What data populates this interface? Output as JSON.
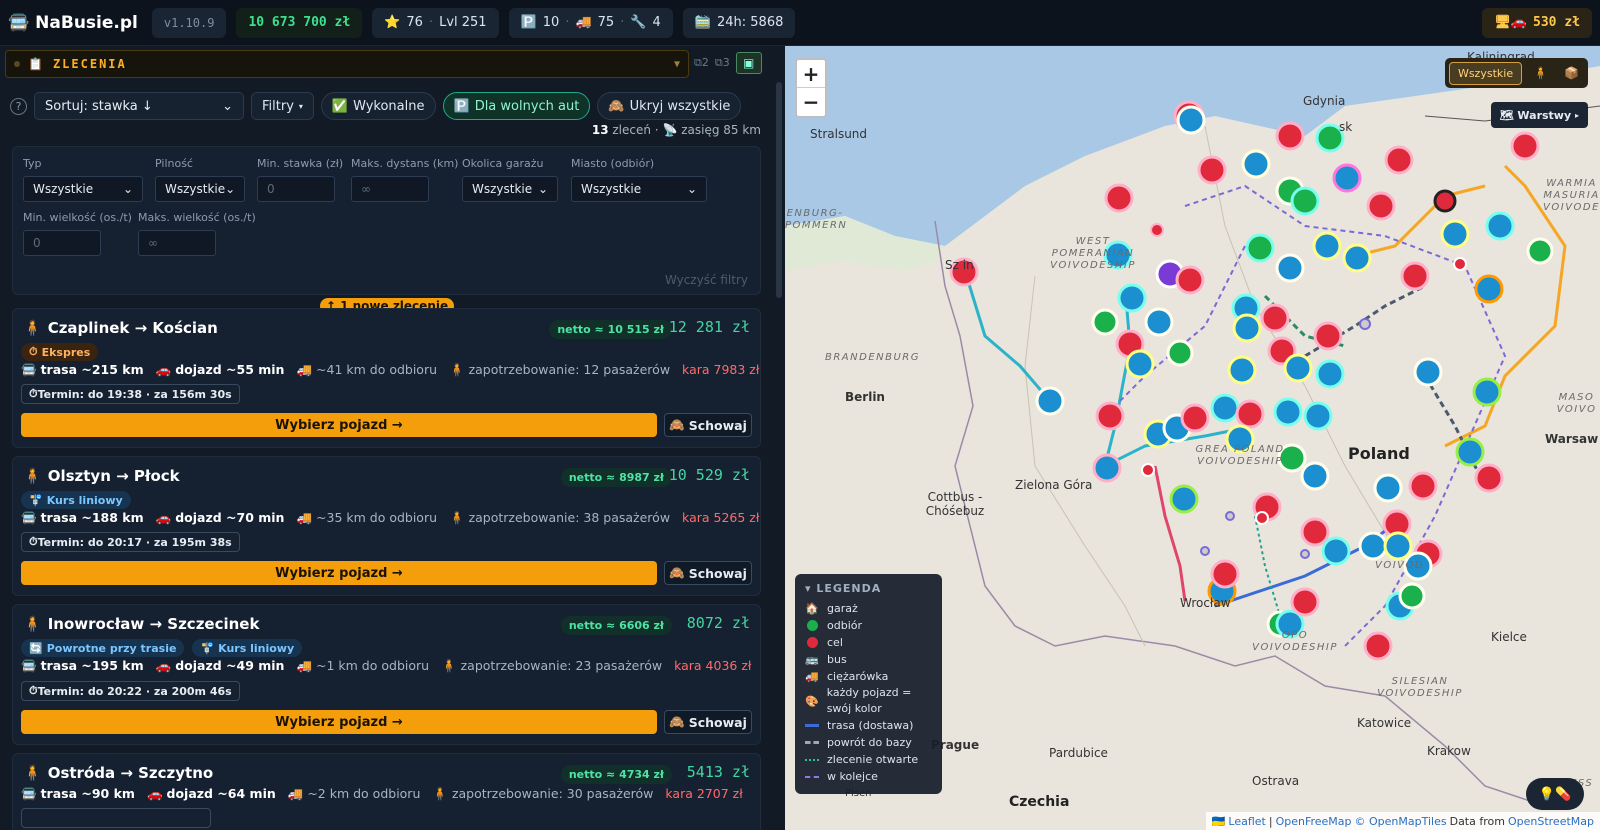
{
  "topbar": {
    "brand": "NaBusie.pl",
    "version": "v1.10.9",
    "money": "10 673 700 zł",
    "stars": "76",
    "level": "Lvl 251",
    "parking": "10",
    "trucks": "75",
    "tools": "4",
    "day24": "24h: 5868",
    "right_money": "530 zł"
  },
  "orders_header": {
    "title": "ZLECENIA",
    "tab2": "2",
    "tab3": "3"
  },
  "controls": {
    "sort": "Sortuj: stawka ↓",
    "filters": "Filtry",
    "done": "Wykonalne",
    "free": "Dla wolnych aut",
    "hide_all": "Ukryj wszystkie",
    "count": "13",
    "count_suffix": "zleceń ·",
    "range": "zasięg 85 km"
  },
  "filters": {
    "type_label": "Typ",
    "type_value": "Wszystkie",
    "urgency_label": "Pilność",
    "urgency_value": "Wszystkie",
    "min_rate_label": "Min. stawka (zł)",
    "min_rate_value": "0",
    "max_dist_label": "Maks. dystans (km)",
    "max_dist_value": "∞",
    "garage_label": "Okolica garażu",
    "garage_value": "Wszystkie",
    "city_label": "Miasto (odbiór)",
    "city_value": "Wszystkie",
    "min_size_label": "Min. wielkość (os./t)",
    "min_size_value": "0",
    "max_size_label": "Maks. wielkość (os./t)",
    "max_size_value": "∞",
    "clear": "Wyczyść filtry"
  },
  "new_badge": "↑ 1 nowe zlecenie",
  "orders": [
    {
      "title": "Czaplinek → Kościan",
      "net": "netto ≈ 10 515 zł",
      "price": "12 281 zł",
      "tags": [
        "Ekspres"
      ],
      "route": "trasa ~215 km",
      "drive": "dojazd ~55 min",
      "pickup": "~41 km do odbioru",
      "demand": "zapotrzebowanie: 12 pasażerów",
      "penalty": "kara 7983 zł",
      "term": "Termin: do 19:38 · za 156m 30s",
      "pick": "Wybierz pojazd →",
      "hide": "Schowaj"
    },
    {
      "title": "Olsztyn → Płock",
      "net": "netto ≈ 8987 zł",
      "price": "10 529 zł",
      "tags": [
        "Kurs liniowy"
      ],
      "route": "trasa ~188 km",
      "drive": "dojazd ~70 min",
      "pickup": "~35 km do odbioru",
      "demand": "zapotrzebowanie: 38 pasażerów",
      "penalty": "kara 5265 zł",
      "term": "Termin: do 20:17 · za 195m 38s",
      "pick": "Wybierz pojazd →",
      "hide": "Schowaj"
    },
    {
      "title": "Inowrocław → Szczecinek",
      "net": "netto ≈ 6606 zł",
      "price": "8072 zł",
      "tags": [
        "Powrotne przy trasie",
        "Kurs liniowy"
      ],
      "route": "trasa ~195 km",
      "drive": "dojazd ~49 min",
      "pickup": "~1 km do odbioru",
      "demand": "zapotrzebowanie: 23 pasażerów",
      "penalty": "kara 4036 zł",
      "term": "Termin: do 20:22 · za 200m 46s",
      "pick": "Wybierz pojazd →",
      "hide": "Schowaj"
    },
    {
      "title": "Ostróda → Szczytno",
      "net": "netto ≈ 4734 zł",
      "price": "5413 zł",
      "route": "trasa ~90 km",
      "drive": "dojazd ~64 min",
      "pickup": "~2 km do odbioru",
      "demand": "zapotrzebowanie: 30 pasażerów",
      "penalty": "kara 2707 zł"
    }
  ],
  "map": {
    "filter_all": "Wszystkie",
    "layers": "Warstwy",
    "labels": {
      "gdynia": "Gdynia",
      "stralsund": "Stralsund",
      "kaliningrad": "Kaliningrad",
      "sk": "sk",
      "west_pom": "WEST POMERANIAN VOIVODESHIP",
      "warmia": "WARMIA MASURIA VOIVODE",
      "brandenburg": "BRANDENBURG",
      "nburg": "ENBURG-POMMERN",
      "berlin": "Berlin",
      "sin": "Sz in",
      "poland": "Poland",
      "warsaw": "Warsaw",
      "mas": "MASO VOIVO",
      "zielona": "Zielona Góra",
      "cottbus": "Cottbus - Chóśebuz",
      "greater": "GREA POLAND VOIVODESHIP",
      "lodz": "VOIVOD",
      "wroclaw": "Wrocław",
      "opole": "OPO VOIVODESHIP",
      "silesian": "SILESIAN VOIVODESHIP",
      "kielce": "Kielce",
      "katowice": "Katowice",
      "krakow": "Krakow",
      "less": "LESS",
      "prague": "Prague",
      "pardubice": "Pardubice",
      "ostrava": "Ostrava",
      "czechia": "Czechia",
      "plsen": "Plsen"
    },
    "legend": {
      "title": "LEGENDA",
      "garage": "garaż",
      "pickup": "odbiór",
      "target": "cel",
      "bus": "bus",
      "truck": "ciężarówka",
      "own_color": "każdy pojazd = swój kolor",
      "route": "trasa (dostawa)",
      "return": "powrót do bazy",
      "open": "zlecenie otwarte",
      "queue": "w kolejce"
    },
    "attribution": {
      "leaflet": "Leaflet",
      "sep1": "|",
      "ofm": "OpenFreeMap",
      "omt": "© OpenMapTiles",
      "data": "Data from",
      "osm": "OpenStreetMap"
    }
  }
}
